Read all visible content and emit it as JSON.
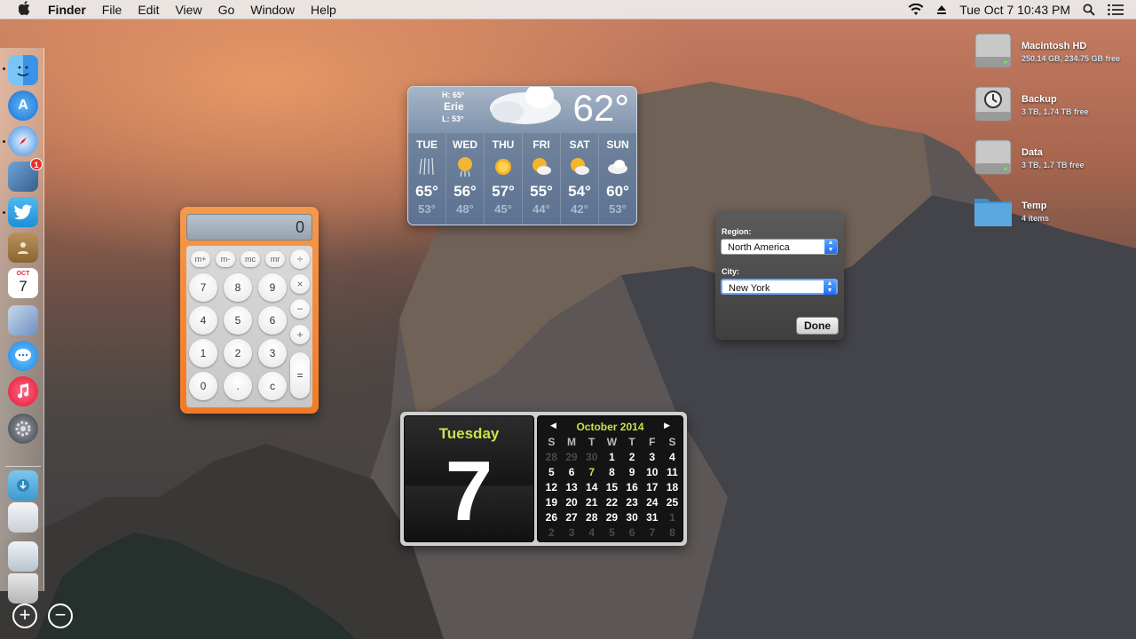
{
  "menubar": {
    "apple_icon": "apple-logo-icon",
    "app_name": "Finder",
    "menus": [
      "File",
      "Edit",
      "View",
      "Go",
      "Window",
      "Help"
    ],
    "datetime": "Tue Oct 7  10:43 PM"
  },
  "dock": {
    "items": [
      "Finder",
      "App Store",
      "Safari",
      "Preview",
      "Twitter",
      "Contacts",
      "Calendar",
      "Photo Booth",
      "Messages",
      "iTunes",
      "System Preferences"
    ],
    "badge_count": "1",
    "calendar_icon_month": "OCT",
    "calendar_icon_day": "7"
  },
  "desktop_icons": [
    {
      "name": "Macintosh HD",
      "info": "250.14 GB, 234.75 GB free"
    },
    {
      "name": "Backup",
      "info": "3 TB, 1.74 TB free"
    },
    {
      "name": "Data",
      "info": "3 TB, 1.7 TB free"
    },
    {
      "name": "Temp",
      "info": "4 items"
    }
  ],
  "calculator": {
    "display": "0",
    "memory_keys": [
      "m+",
      "m-",
      "mc",
      "mr"
    ],
    "keys": [
      "7",
      "8",
      "9",
      "4",
      "5",
      "6",
      "1",
      "2",
      "3",
      "0",
      ".",
      "c"
    ],
    "ops": [
      "÷",
      "×",
      "−",
      "+",
      "="
    ]
  },
  "weather": {
    "city": "Erie",
    "high": "H: 65°",
    "low": "L: 53°",
    "current": "62°",
    "forecast": [
      {
        "day": "TUE",
        "hi": "65°",
        "lo": "53°",
        "icon": "rain-icon"
      },
      {
        "day": "WED",
        "hi": "56°",
        "lo": "48°",
        "icon": "sun-rain-icon"
      },
      {
        "day": "THU",
        "hi": "57°",
        "lo": "45°",
        "icon": "sun-icon"
      },
      {
        "day": "FRI",
        "hi": "55°",
        "lo": "44°",
        "icon": "partly-cloudy-icon"
      },
      {
        "day": "SAT",
        "hi": "54°",
        "lo": "42°",
        "icon": "partly-cloudy-icon"
      },
      {
        "day": "SUN",
        "hi": "60°",
        "lo": "53°",
        "icon": "cloudy-icon"
      }
    ]
  },
  "weather_prefs": {
    "region_label": "Region:",
    "region_value": "North America",
    "city_label": "City:",
    "city_value": "New York",
    "done_label": "Done"
  },
  "calendar": {
    "weekday": "Tuesday",
    "day": "7",
    "month_title": "October 2014",
    "headers": [
      "S",
      "M",
      "T",
      "W",
      "T",
      "F",
      "S"
    ],
    "weeks": [
      [
        "28",
        "29",
        "30",
        "1",
        "2",
        "3",
        "4"
      ],
      [
        "5",
        "6",
        "7",
        "8",
        "9",
        "10",
        "11"
      ],
      [
        "12",
        "13",
        "14",
        "15",
        "16",
        "17",
        "18"
      ],
      [
        "19",
        "20",
        "21",
        "22",
        "23",
        "24",
        "25"
      ],
      [
        "26",
        "27",
        "28",
        "29",
        "30",
        "31",
        "1"
      ],
      [
        "2",
        "3",
        "4",
        "5",
        "6",
        "7",
        "8"
      ]
    ],
    "accent_color": "#c8e34a"
  },
  "dashboard": {
    "add_label": "+",
    "remove_label": "−"
  }
}
